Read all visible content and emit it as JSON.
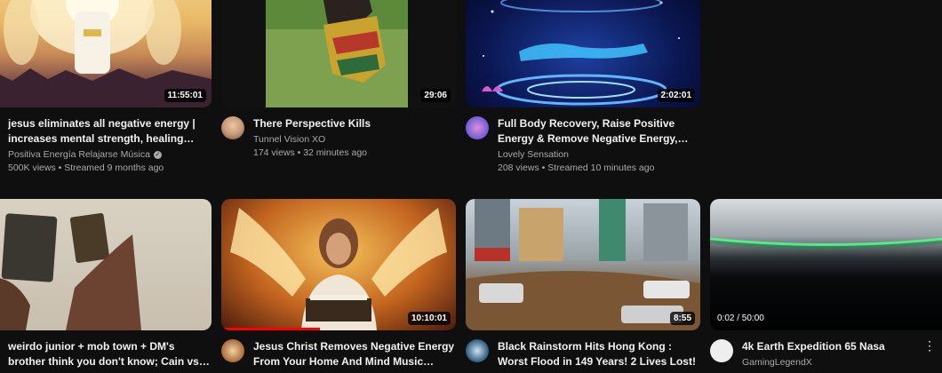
{
  "videos": [
    {
      "title": "jesus eliminates all negative energy | increases mental strength, healing…",
      "channel": "Positiva Energía Relajarse Música",
      "verified": true,
      "stats": "500K views • Streamed 9 months ago",
      "duration": "11:55:01",
      "show_avatar": false
    },
    {
      "title": "There Perspective Kills",
      "channel": "Tunnel Vision XO",
      "stats": "174 views • 32 minutes ago",
      "duration": "29:06",
      "show_avatar": true
    },
    {
      "title": "Full Body Recovery, Raise Positive Energy & Remove Negative Energy,…",
      "channel": "Lovely Sensation",
      "stats": "208 views • Streamed 10 minutes ago",
      "duration": "2:02:01",
      "show_avatar": true
    },
    {
      "title": "weirdo junior + mob town + DM's brother think you don't know; Cain vs Abel over…",
      "channel": "",
      "stats": "",
      "duration": "",
      "show_avatar": false
    },
    {
      "title": "Jesus Christ Removes Negative Energy From Your Home And Mind Music heal…",
      "channel": "",
      "stats": "",
      "duration": "10:10:01",
      "watch_progress": 0.42,
      "show_avatar": true
    },
    {
      "title": "Black Rainstorm Hits Hong Kong : Worst Flood in 149 Years! 2 Lives Lost!",
      "channel": "",
      "stats": "",
      "duration": "8:55",
      "show_avatar": true
    },
    {
      "title": "4k Earth Expedition 65 Nasa",
      "channel": "GamingLegendX",
      "stats": "",
      "hover_time": "0:02 / 50:00",
      "show_avatar": true,
      "menu_icon": "more-vert-icon"
    }
  ],
  "colors": {
    "background": "#0f0f0f",
    "progress": "#ff0000",
    "meta_text": "#aaaaaa"
  }
}
